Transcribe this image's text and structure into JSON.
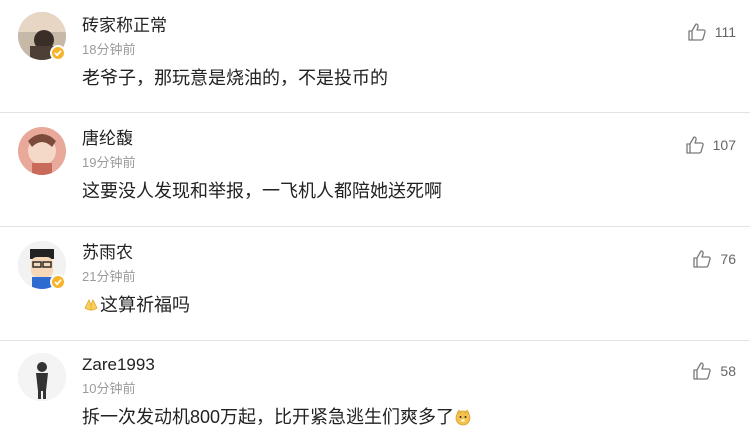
{
  "comments": [
    {
      "username": "砖家称正常",
      "time": "18分钟前",
      "text": "老爷子，那玩意是烧油的，不是投币的",
      "likes": "111",
      "verified": true
    },
    {
      "username": "唐纶馥",
      "time": "19分钟前",
      "text": "这要没人发现和举报，一飞机人都陪她送死啊",
      "likes": "107",
      "verified": false
    },
    {
      "username": "苏雨农",
      "time": "21分钟前",
      "text": "这算祈福吗",
      "emoji_before": "praying-hands-emoji",
      "likes": "76",
      "verified": true
    },
    {
      "username": "Zare1993",
      "time": "10分钟前",
      "text": "拆一次发动机800万起，比开紧急逃生们爽多了",
      "emoji_after": "doge-emoji",
      "likes": "58",
      "verified": false
    }
  ],
  "icons": {
    "like": "thumbs-up-icon",
    "verified": "verified-badge-icon"
  },
  "colors": {
    "badge": "#f5b42a",
    "muted_text": "#9b9b9b",
    "divider": "#e3e3e3"
  }
}
